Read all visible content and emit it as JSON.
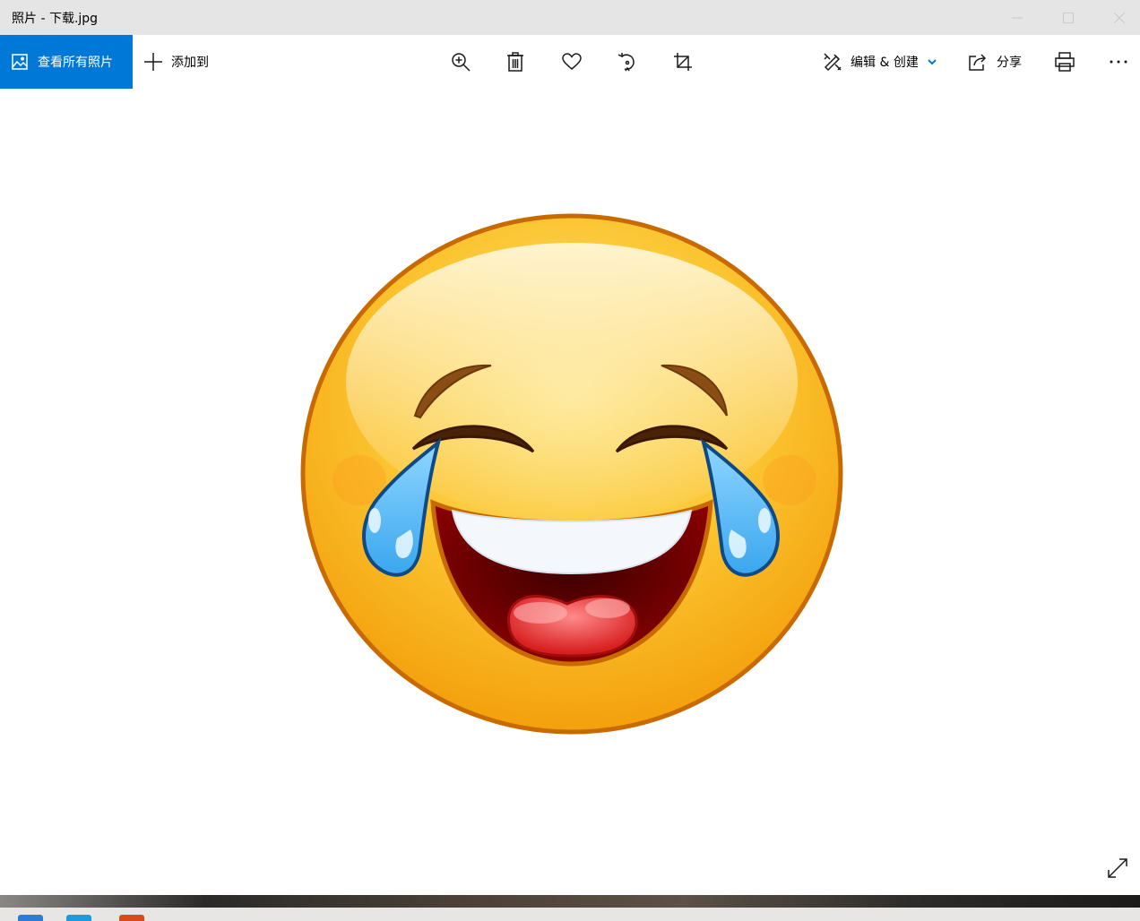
{
  "window": {
    "title": "照片 - 下载.jpg",
    "controls": [
      "minimize-icon",
      "maximize-icon",
      "close-icon"
    ]
  },
  "toolbar": {
    "view_all_label": "查看所有照片",
    "add_to_label": "添加到",
    "buttons": [
      "zoom-icon",
      "delete-icon",
      "favorite-icon",
      "rotate-icon",
      "crop-icon"
    ],
    "edit_create_label": "编辑 & 创建",
    "share_label": "分享",
    "print_icon": "print-icon",
    "more_icon": "more-icon"
  },
  "viewer": {
    "image_subject": "tears-of-joy-emoji",
    "fullscreen_icon": "expand-icon"
  },
  "colors": {
    "accent": "#0078d7",
    "titlebar": "#e5e5e5",
    "toolbar": "#ffffff"
  }
}
